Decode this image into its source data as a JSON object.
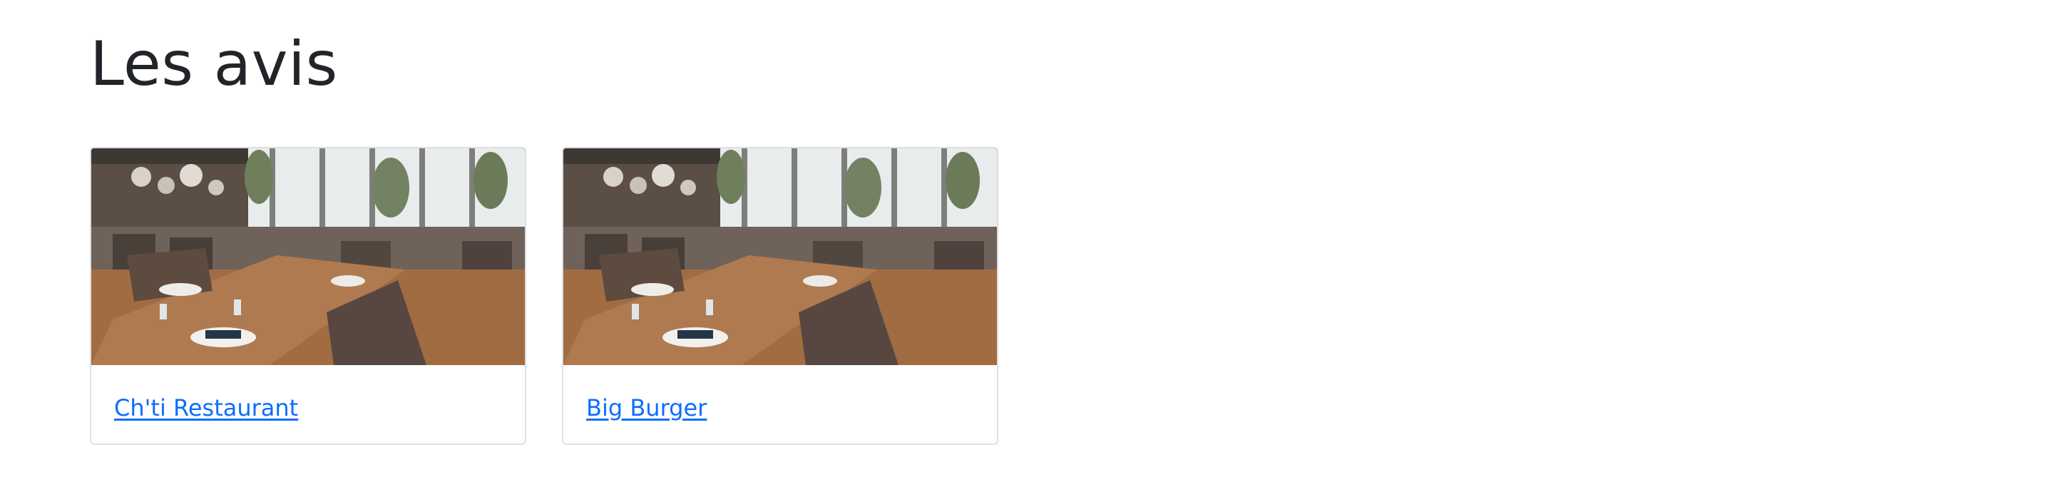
{
  "page": {
    "title": "Les avis"
  },
  "cards": [
    {
      "image": "restaurant-dining-room-photo",
      "link_label": "Ch'ti Restaurant"
    },
    {
      "image": "restaurant-dining-room-photo",
      "link_label": "Big Burger"
    }
  ],
  "colors": {
    "link": "#0d6efd",
    "text": "#212529",
    "card_border": "#dfdfdf"
  }
}
